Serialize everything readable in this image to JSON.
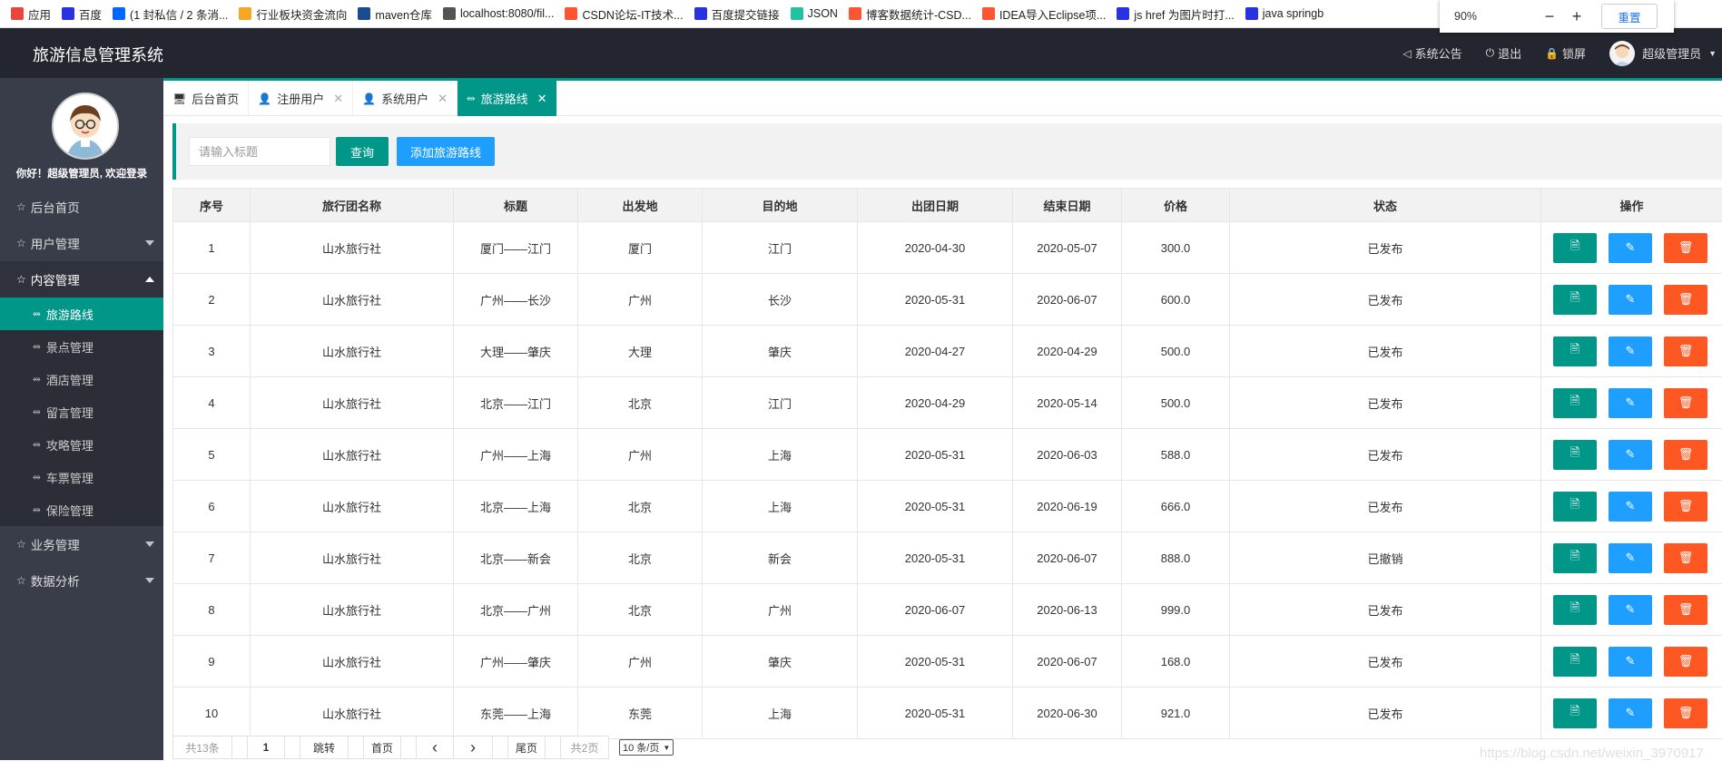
{
  "bookmarks": [
    {
      "label": "应用",
      "icon": "apps-grid-icon",
      "color": "#e8453c"
    },
    {
      "label": "百度",
      "icon": "baidu-paw-icon",
      "color": "#2932e1"
    },
    {
      "label": "(1 封私信 / 2 条消...",
      "icon": "zhihu-icon",
      "color": "#0066ff"
    },
    {
      "label": "行业板块资金流向",
      "icon": "flag-icon",
      "color": "#f5a623"
    },
    {
      "label": "maven仓库",
      "icon": "mvn-icon",
      "color": "#1a4d8f"
    },
    {
      "label": "localhost:8080/fil...",
      "icon": "globe-icon",
      "color": "#555555"
    },
    {
      "label": "CSDN论坛-IT技术...",
      "icon": "csdn-icon",
      "color": "#fc5531"
    },
    {
      "label": "百度提交链接",
      "icon": "baidu-paw-icon",
      "color": "#2932e1"
    },
    {
      "label": "JSON",
      "icon": "json-icon",
      "color": "#22c1a0"
    },
    {
      "label": "博客数据统计-CSD...",
      "icon": "csdn-icon",
      "color": "#fc5531"
    },
    {
      "label": "IDEA导入Eclipse项...",
      "icon": "csdn-icon",
      "color": "#fc5531"
    },
    {
      "label": "js href 为图片时打...",
      "icon": "baidu-paw-icon",
      "color": "#2932e1"
    },
    {
      "label": "java springb",
      "icon": "baidu-paw-icon",
      "color": "#2932e1"
    }
  ],
  "zoom": {
    "value": "90%",
    "minus": "−",
    "plus": "+",
    "reset": "重置"
  },
  "header": {
    "title": "旅游信息管理系统",
    "notice": "系统公告",
    "logout": "退出",
    "lock": "锁屏",
    "user": "超级管理员"
  },
  "sidebar": {
    "welcome": "你好！超级管理员, 欢迎登录",
    "items": [
      {
        "label": "后台首页"
      },
      {
        "label": "用户管理"
      },
      {
        "label": "内容管理"
      },
      {
        "label": "业务管理"
      },
      {
        "label": "数据分析"
      }
    ],
    "sub_items": [
      {
        "label": "旅游路线"
      },
      {
        "label": "景点管理"
      },
      {
        "label": "酒店管理"
      },
      {
        "label": "留言管理"
      },
      {
        "label": "攻略管理"
      },
      {
        "label": "车票管理"
      },
      {
        "label": "保险管理"
      }
    ]
  },
  "tabs": [
    {
      "label": "后台首页",
      "icon": "monitor-icon"
    },
    {
      "label": "注册用户",
      "icon": "user-icon",
      "close": "✕"
    },
    {
      "label": "系统用户",
      "icon": "user-icon",
      "close": "✕"
    },
    {
      "label": "旅游路线",
      "icon": "route-icon",
      "close": "✕"
    }
  ],
  "toolbar": {
    "search_placeholder": "请输入标题",
    "query_label": "查询",
    "add_label": "添加旅游路线"
  },
  "table": {
    "headers": [
      "序号",
      "旅行团名称",
      "标题",
      "出发地",
      "目的地",
      "出团日期",
      "结束日期",
      "价格",
      "状态",
      "操作"
    ],
    "rows": [
      [
        "1",
        "山水旅行社",
        "厦门——江门",
        "厦门",
        "江门",
        "2020-04-30",
        "2020-05-07",
        "300.0",
        "已发布"
      ],
      [
        "2",
        "山水旅行社",
        "广州——长沙",
        "广州",
        "长沙",
        "2020-05-31",
        "2020-06-07",
        "600.0",
        "已发布"
      ],
      [
        "3",
        "山水旅行社",
        "大理——肇庆",
        "大理",
        "肇庆",
        "2020-04-27",
        "2020-04-29",
        "500.0",
        "已发布"
      ],
      [
        "4",
        "山水旅行社",
        "北京——江门",
        "北京",
        "江门",
        "2020-04-29",
        "2020-05-14",
        "500.0",
        "已发布"
      ],
      [
        "5",
        "山水旅行社",
        "广州——上海",
        "广州",
        "上海",
        "2020-05-31",
        "2020-06-03",
        "588.0",
        "已发布"
      ],
      [
        "6",
        "山水旅行社",
        "北京——上海",
        "北京",
        "上海",
        "2020-05-31",
        "2020-06-19",
        "666.0",
        "已发布"
      ],
      [
        "7",
        "山水旅行社",
        "北京——新会",
        "北京",
        "新会",
        "2020-05-31",
        "2020-06-07",
        "888.0",
        "已撤销"
      ],
      [
        "8",
        "山水旅行社",
        "北京——广州",
        "北京",
        "广州",
        "2020-06-07",
        "2020-06-13",
        "999.0",
        "已发布"
      ],
      [
        "9",
        "山水旅行社",
        "广州——肇庆",
        "广州",
        "肇庆",
        "2020-05-31",
        "2020-06-07",
        "168.0",
        "已发布"
      ],
      [
        "10",
        "山水旅行社",
        "东莞——上海",
        "东莞",
        "上海",
        "2020-05-31",
        "2020-06-30",
        "921.0",
        "已发布"
      ]
    ]
  },
  "pager": {
    "total": "共13条",
    "page_input": "1",
    "jump": "跳转",
    "first": "首页",
    "prev": "‹",
    "next": "›",
    "last": "尾页",
    "pages": "共2页",
    "page_size": "10 条/页"
  },
  "watermark": "https://blog.csdn.net/weixin_3970917"
}
